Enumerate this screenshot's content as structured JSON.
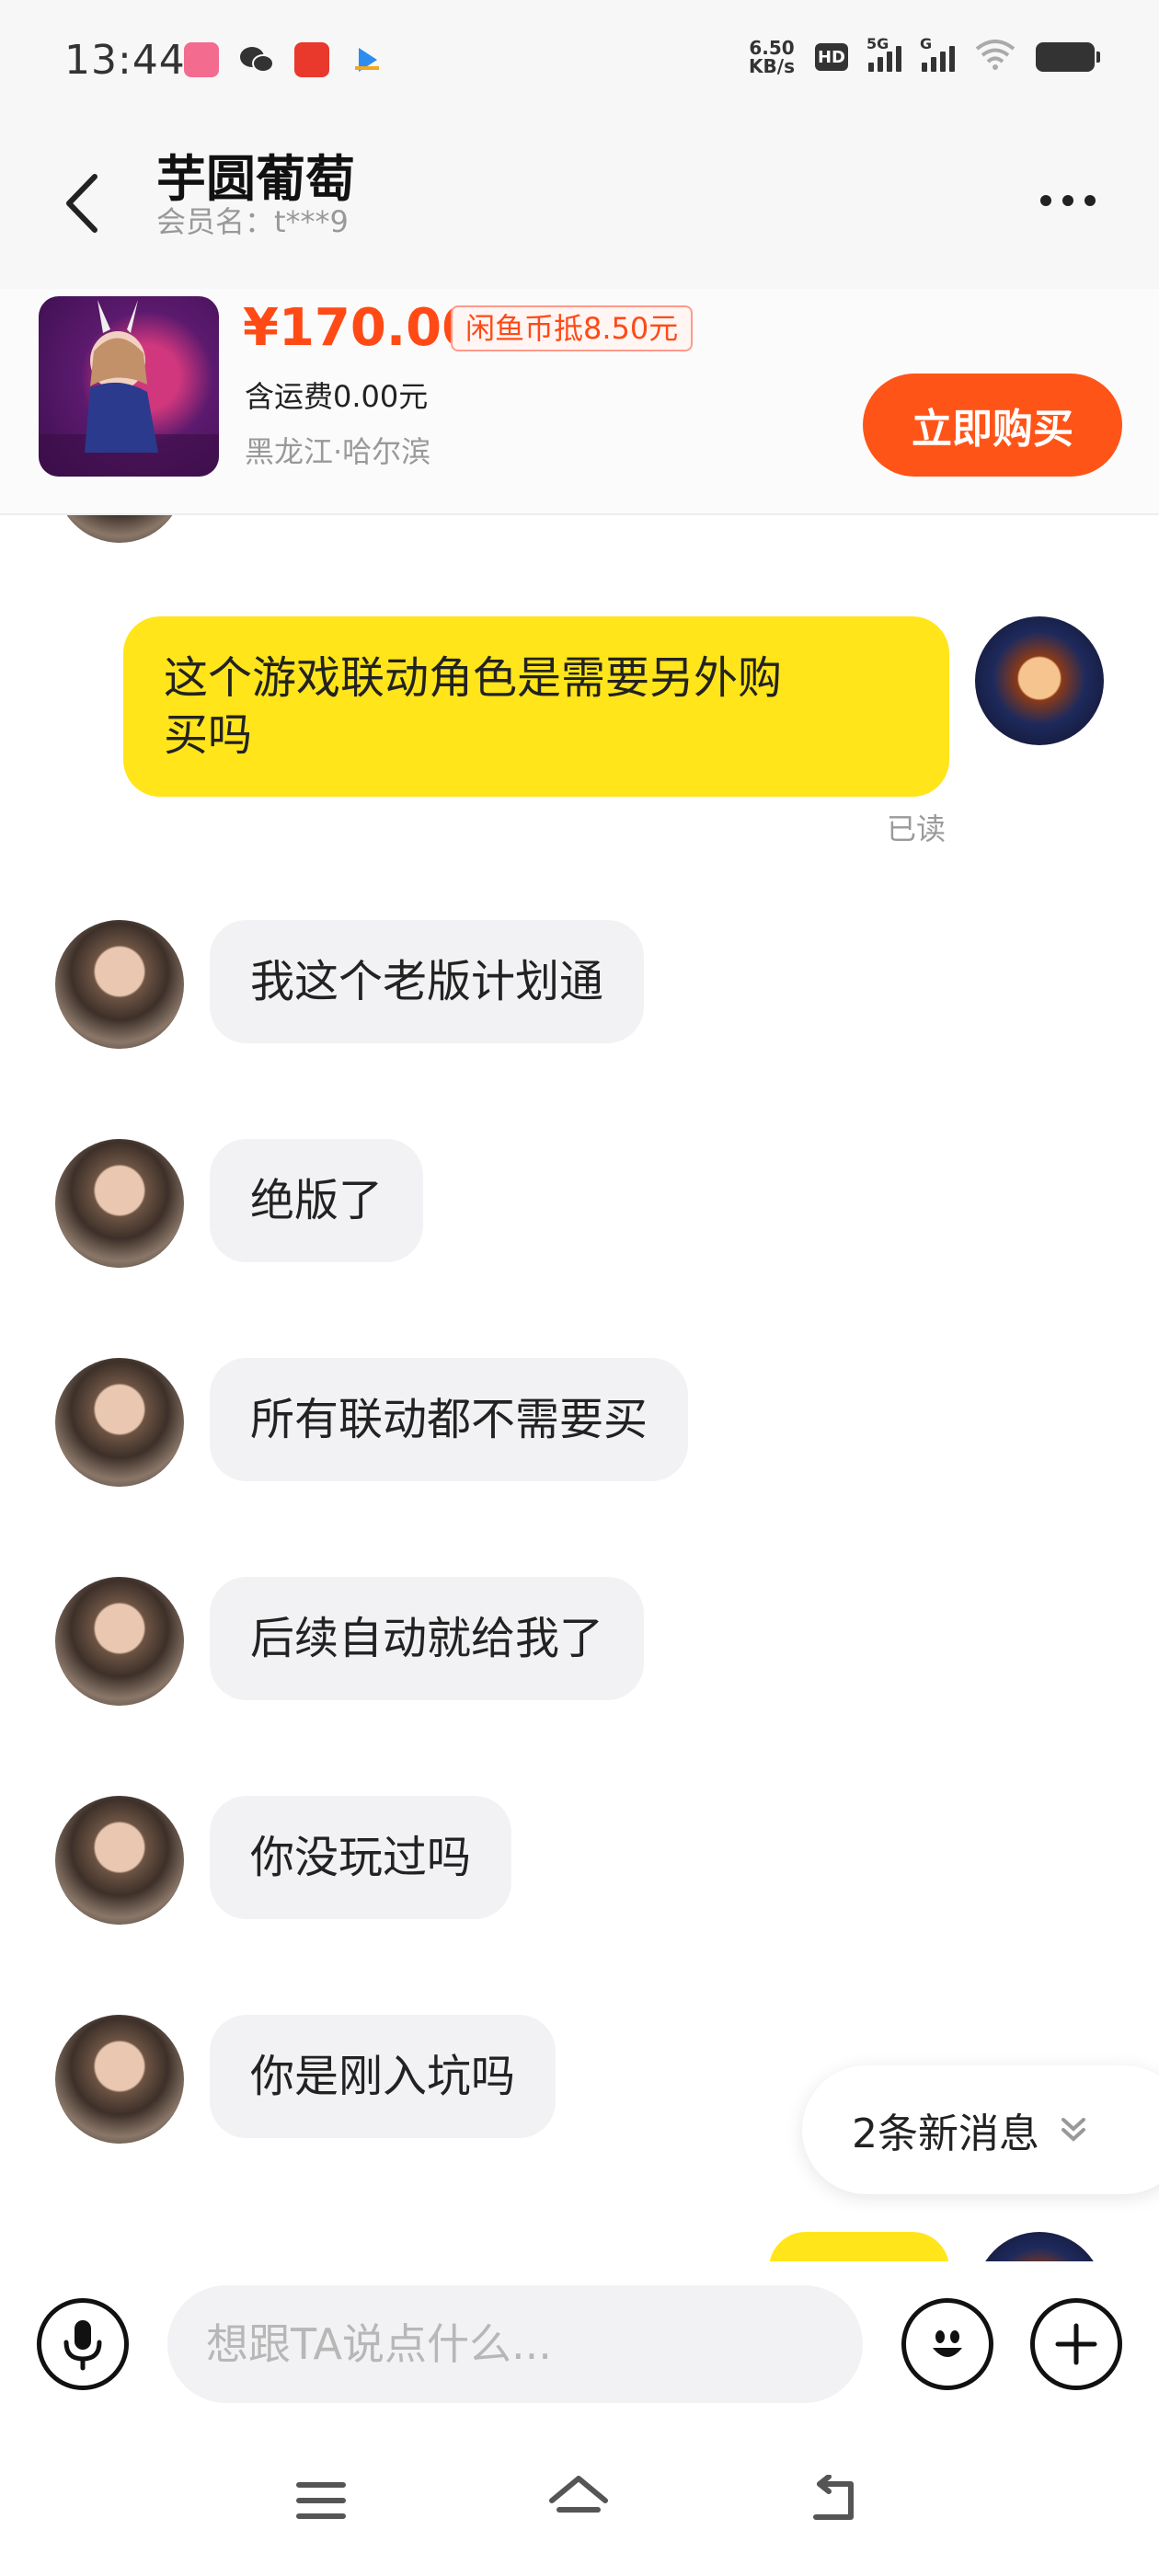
{
  "status_bar": {
    "time": "13:44",
    "app_icons": [
      "bilibili-icon",
      "wechat-icon",
      "listen-app-icon",
      "video-app-icon"
    ],
    "network_speed_value": "6.50",
    "network_speed_unit": "KB/s",
    "hd_label": "HD",
    "sim1_type": "5G",
    "sim2_type": "G",
    "battery_level": 1.0
  },
  "header": {
    "title": "芋圆葡萄",
    "member": "会员名：t***9"
  },
  "product": {
    "price": "¥170.00",
    "coin_offer": "闲鱼币抵8.50元",
    "shipping": "含运费0.00元",
    "location": "黑龙江·哈尔滨",
    "buy_label": "立即购买"
  },
  "messages": [
    {
      "from": "me",
      "text": "这个游戏联动角色是需要另外购买吗",
      "line1": "这个游戏联动角色是需要另外购",
      "line2": "买吗"
    },
    {
      "from": "other",
      "text": "我这个老版计划通"
    },
    {
      "from": "other",
      "text": "绝版了"
    },
    {
      "from": "other",
      "text": "所有联动都不需要买"
    },
    {
      "from": "other",
      "text": "后续自动就给我了"
    },
    {
      "from": "other",
      "text": "你没玩过吗"
    },
    {
      "from": "other",
      "text": "你是刚入坑吗"
    }
  ],
  "read_status": "已读",
  "new_messages": "2条新消息",
  "input": {
    "placeholder": "想跟TA说点什么..."
  },
  "colors": {
    "accent": "#ff5418",
    "price": "#ff4a16",
    "my_bubble": "#ffe51a",
    "other_bubble": "#f2f2f4"
  }
}
